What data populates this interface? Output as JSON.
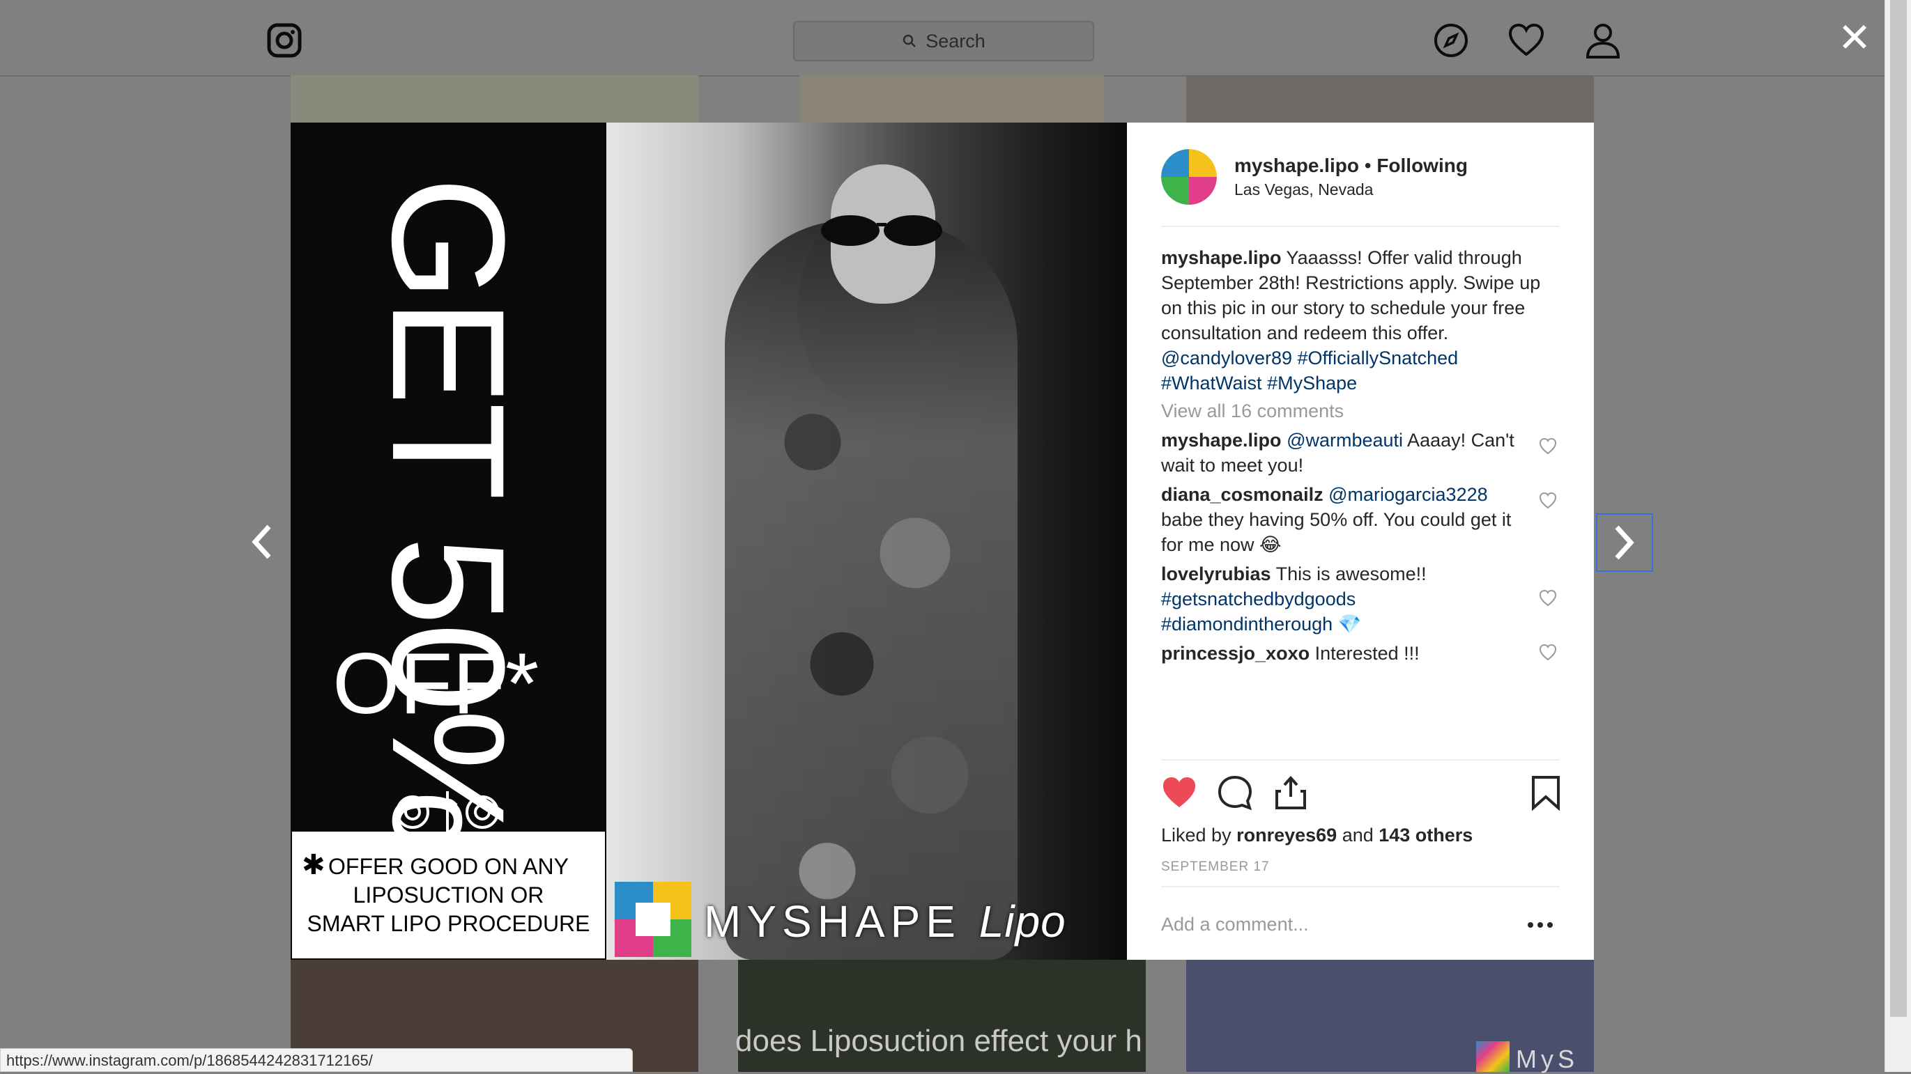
{
  "topbar": {
    "search_placeholder": "Search"
  },
  "background_tiles": {
    "video_caption": "does Liposuction effect your h",
    "brand_fragment": "MyS"
  },
  "post": {
    "image": {
      "promo_big": "GET 50%",
      "promo_off": "OFF*",
      "promo_note": [
        "OFFER GOOD ON ANY",
        "LIPOSUCTION OR",
        "SMART LIPO PROCEDURE"
      ],
      "promo_note_star": "✱",
      "brand_main": "MYSHAPE",
      "brand_italic": "Lipo"
    },
    "header": {
      "username": "myshape.lipo",
      "separator": " • ",
      "follow_state": "Following",
      "location": "Las Vegas, Nevada"
    },
    "caption": {
      "username": "myshape.lipo",
      "text": " Yaaasss! Offer valid through September 28th! Restrictions apply. Swipe up on this pic in our story to schedule your free consultation and redeem this offer. ",
      "mention": "@candylover89",
      "tags": [
        "#OfficiallySnatched",
        "#WhatWaist",
        "#MyShape"
      ]
    },
    "view_all_comments": "View all 16 comments",
    "comments": [
      {
        "username": "myshape.lipo",
        "mention": "@warmbeauti",
        "text": " Aaaay! Can't wait to meet you!"
      },
      {
        "username": "diana_cosmonailz",
        "mention": "@mariogarcia3228",
        "text": " babe they having 50% off. You could get it for me now 😂"
      },
      {
        "username": "lovelyrubias",
        "text": " This is awesome!! ",
        "tags": [
          "#getsnatchedbydgoods",
          "#diamondintherough"
        ],
        "emoji": "💎"
      },
      {
        "username": "princessjo_xoxo",
        "text": " Interested !!!"
      }
    ],
    "likes": {
      "prefix": "Liked by ",
      "user": "ronreyes69",
      "middle": " and ",
      "others": "143 others"
    },
    "date": "SEPTEMBER 17",
    "comment_placeholder": "Add a comment..."
  },
  "status_bar_url": "https://www.instagram.com/p/1868544242831712165/",
  "colors": {
    "heart_liked": "#ed4956",
    "link": "#003569",
    "overlay": "#808080"
  },
  "icons": [
    "instagram-icon",
    "search-icon",
    "compass-icon",
    "heart-icon",
    "profile-icon",
    "close-icon",
    "chevron-left-icon",
    "chevron-right-icon",
    "like-icon",
    "comment-icon",
    "share-icon",
    "bookmark-icon",
    "more-icon"
  ]
}
